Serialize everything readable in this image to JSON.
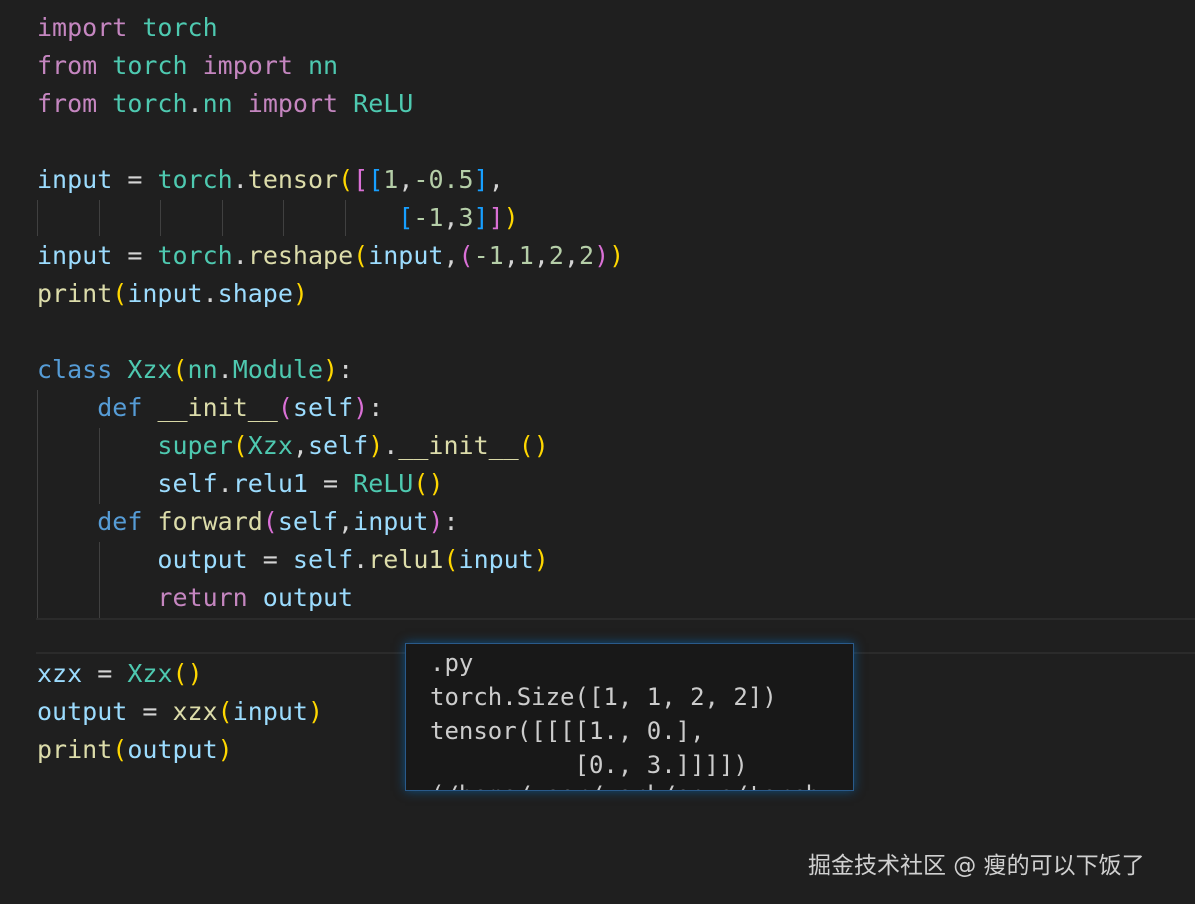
{
  "editor": {
    "lines": {
      "l1": [
        "import",
        "torch"
      ],
      "l2": [
        "from",
        "torch",
        "import",
        "nn"
      ],
      "l3": [
        "from",
        "torch",
        ".",
        "nn",
        "import",
        "ReLU"
      ],
      "l5": [
        "input",
        "=",
        "torch",
        ".",
        "tensor",
        "(",
        "[",
        "[",
        "1",
        ",",
        "-0.5",
        "]",
        ","
      ],
      "l6": [
        "[",
        "-1",
        ",",
        "3",
        "]",
        "]",
        ")"
      ],
      "l7": [
        "input",
        "=",
        "torch",
        ".",
        "reshape",
        "(",
        "input",
        ",",
        "(",
        "-1",
        ",",
        "1",
        ",",
        "2",
        ",",
        "2",
        ")",
        ")"
      ],
      "l8": [
        "print",
        "(",
        "input",
        ".",
        "shape",
        ")"
      ],
      "l10": [
        "class",
        "Xzx",
        "(",
        "nn",
        ".",
        "Module",
        ")",
        ":"
      ],
      "l11": [
        "def",
        "__init__",
        "(",
        "self",
        ")",
        ":"
      ],
      "l12": [
        "super",
        "(",
        "Xzx",
        ",",
        "self",
        ")",
        ".",
        "__init__",
        "(",
        ")"
      ],
      "l13": [
        "self",
        ".",
        "relu1",
        "=",
        "ReLU",
        "(",
        ")"
      ],
      "l14": [
        "def",
        "forward",
        "(",
        "self",
        ",",
        "input",
        ")",
        ":"
      ],
      "l15": [
        "output",
        "=",
        "self",
        ".",
        "relu1",
        "(",
        "input",
        ")"
      ],
      "l16": [
        "return",
        "output"
      ],
      "l18": [
        "xzx",
        "=",
        "Xzx",
        "(",
        ")"
      ],
      "l19": [
        "output",
        "=",
        "xzx",
        "(",
        "input",
        ")"
      ],
      "l20": [
        "print",
        "(",
        "output",
        ")"
      ]
    }
  },
  "popup": {
    "lines": [
      ".py",
      "torch.Size([1, 1, 2, 2])",
      "tensor([[[[1., 0.],",
      "          [0., 3.]]]])",
      "(/home/user/work/envs/torch..."
    ]
  },
  "watermark": "掘金技术社区 @ 瘦的可以下饭了"
}
